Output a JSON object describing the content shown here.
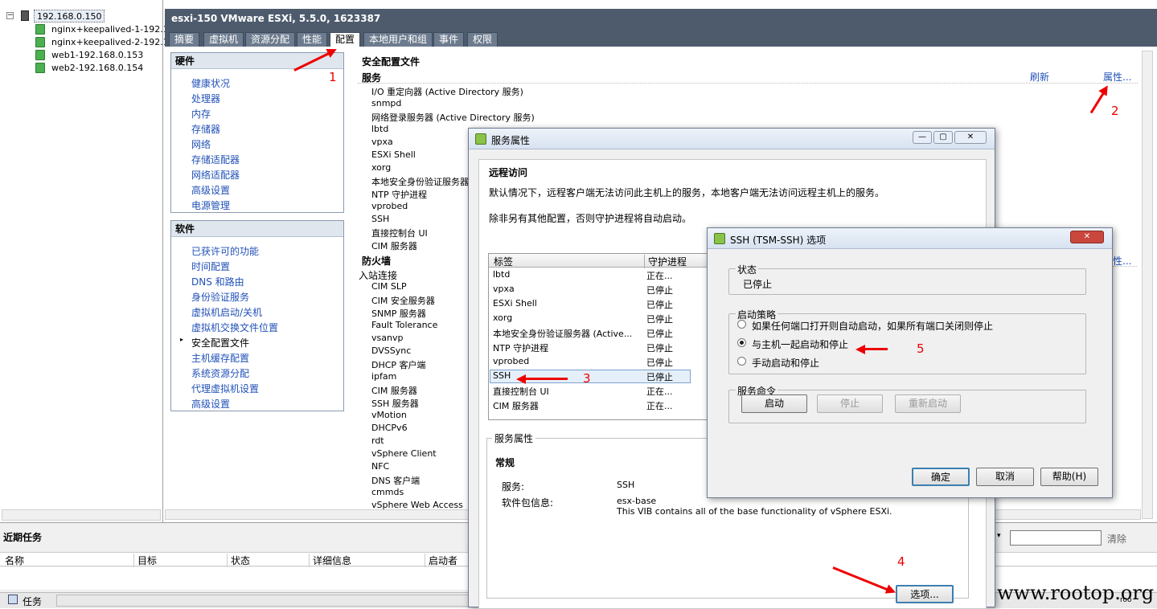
{
  "tree": {
    "host": "192.168.0.150",
    "vms": [
      "nginx+keepalived-1-192.16",
      "nginx+keepalived-2-192.16",
      "web1-192.168.0.153",
      "web2-192.168.0.154"
    ]
  },
  "header": {
    "title": "esxi-150 VMware ESXi, 5.5.0, 1623387"
  },
  "tabs": [
    "摘要",
    "虚拟机",
    "资源分配",
    "性能",
    "配置",
    "本地用户和组",
    "事件",
    "权限"
  ],
  "hardware": {
    "title": "硬件",
    "items": [
      "健康状况",
      "处理器",
      "内存",
      "存储器",
      "网络",
      "存储适配器",
      "网络适配器",
      "高级设置",
      "电源管理"
    ]
  },
  "software": {
    "title": "软件",
    "items": [
      "已获许可的功能",
      "时间配置",
      "DNS 和路由",
      "身份验证服务",
      "虚拟机启动/关机",
      "虚拟机交换文件位置",
      "安全配置文件",
      "主机缓存配置",
      "系统资源分配",
      "代理虚拟机设置",
      "高级设置"
    ]
  },
  "security": {
    "title": "安全配置文件",
    "services_label": "服务",
    "refresh": "刷新",
    "properties": "属性...",
    "properties2": "性...",
    "services": [
      "I/O 重定向器 (Active Directory 服务)",
      "snmpd",
      "网络登录服务器 (Active Directory 服务)",
      "lbtd",
      "vpxa",
      "ESXi Shell",
      "xorg",
      "本地安全身份验证服务器",
      "NTP 守护进程",
      "vprobed",
      "SSH",
      "直接控制台 UI",
      "CIM 服务器"
    ],
    "firewall_label": "防火墙",
    "inbound_label": "入站连接",
    "firewall": [
      "CIM SLP",
      "CIM 安全服务器",
      "SNMP 服务器",
      "Fault Tolerance",
      "vsanvp",
      "DVSSync",
      "DHCP 客户端",
      "ipfam",
      "CIM 服务器",
      "SSH 服务器",
      "vMotion",
      "DHCPv6",
      "rdt",
      "vSphere Client",
      "NFC",
      "DNS 客户端",
      "cmmds",
      "vSphere Web Access"
    ]
  },
  "service_dialog": {
    "title": "服务属性",
    "remote_title": "远程访问",
    "desc1": "默认情况下，远程客户端无法访问此主机上的服务，本地客户端无法访问远程主机上的服务。",
    "desc2": "除非另有其他配置，否则守护进程将自动启动。",
    "col_label": "标签",
    "col_daemon": "守护进程",
    "rows": [
      [
        "lbtd",
        "正在..."
      ],
      [
        "vpxa",
        "已停止"
      ],
      [
        "ESXi Shell",
        "已停止"
      ],
      [
        "xorg",
        "已停止"
      ],
      [
        "本地安全身份验证服务器 (Active...",
        "已停止"
      ],
      [
        "NTP 守护进程",
        "已停止"
      ],
      [
        "vprobed",
        "已停止"
      ],
      [
        "SSH",
        "已停止"
      ],
      [
        "直接控制台 UI",
        "正在..."
      ],
      [
        "CIM 服务器",
        "正在..."
      ]
    ],
    "props_label": "服务属性",
    "general_label": "常规",
    "service_key": "服务:",
    "service_val": "SSH",
    "pkg_key": "软件包信息:",
    "pkg_val1": "esx-base",
    "pkg_val2": "This VIB contains all of the base functionality of vSphere ESXi.",
    "options_btn": "选项..."
  },
  "ssh_dialog": {
    "title": "SSH (TSM-SSH) 选项",
    "status_label": "状态",
    "status_val": "已停止",
    "policy_label": "启动策略",
    "policy_opts": [
      "如果任何端口打开则自动启动，如果所有端口关闭则停止",
      "与主机一起启动和停止",
      "手动启动和停止"
    ],
    "selected": 1,
    "cmd_label": "服务命令",
    "start": "启动",
    "stop": "停止",
    "restart": "重新启动",
    "ok": "确定",
    "cancel": "取消",
    "help": "帮助(H)"
  },
  "tasks": {
    "title": "近期任务",
    "clear": "清除",
    "cols": [
      "名称",
      "目标",
      "状态",
      "详细信息",
      "启动者"
    ],
    "status_tasks": "任务"
  },
  "annotations": [
    "1",
    "2",
    "3",
    "4",
    "5"
  ],
  "watermark": "www.rootop.org",
  "corner": "roo"
}
